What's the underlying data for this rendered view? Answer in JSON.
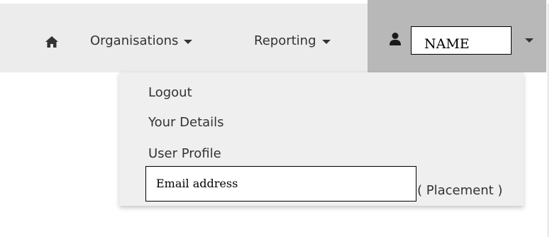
{
  "navbar": {
    "home_icon": "home-icon",
    "organisations_label": "Organisations",
    "reporting_label": "Reporting",
    "user": {
      "icon": "user-icon",
      "name_value": "NAME"
    }
  },
  "dropdown": {
    "items": [
      {
        "label": "Logout"
      },
      {
        "label": "Your Details"
      },
      {
        "label": "User Profile"
      }
    ],
    "email_value": "Email address",
    "placement_label": "( Placement )"
  },
  "colors": {
    "navbar_bg": "#ececec",
    "user_menu_bg": "#b8b8b8",
    "dropdown_bg": "#efefef",
    "text": "#333333"
  }
}
